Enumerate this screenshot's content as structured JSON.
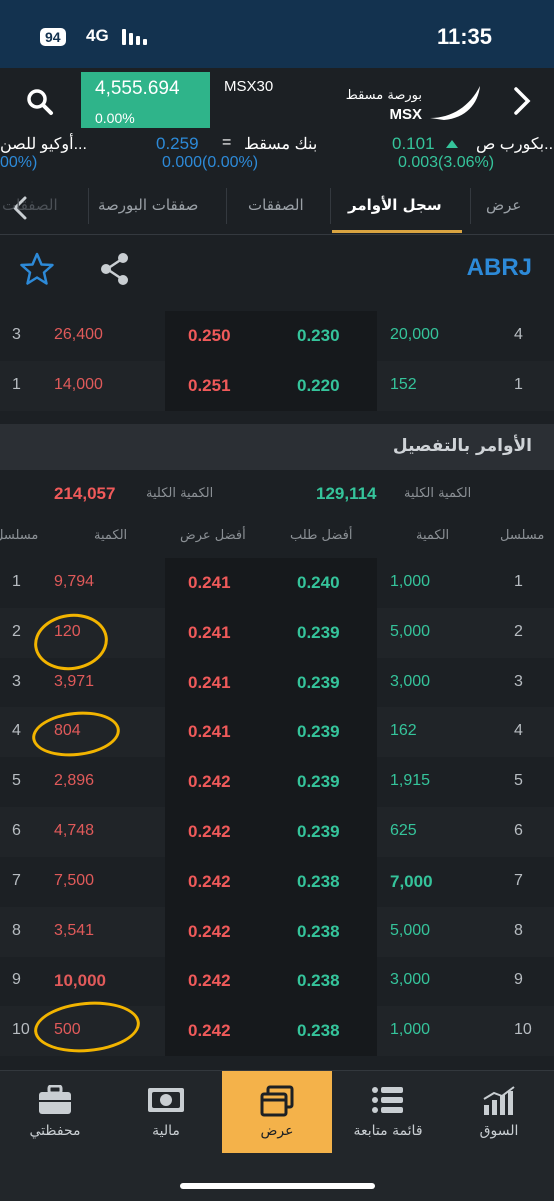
{
  "status": {
    "battery": "94",
    "network": "4G",
    "time": "11:35"
  },
  "header": {
    "index_value": "4,555.694",
    "index_change": "0.00%",
    "index_name": "MSX30",
    "brand_line1": "بورصة مسقط",
    "brand_line2": "MSX"
  },
  "ticker": [
    {
      "name": "أوكيو للصن...",
      "pct": "00%)"
    },
    {
      "name": "بنك مسقط",
      "price": "0.259",
      "mark": "=",
      "change": "0.000(0.00%)"
    },
    {
      "name": "بكورب ص...",
      "price": "0.101",
      "change": "0.003(3.06%)"
    }
  ],
  "tabs": [
    "عرض",
    "سجل الأوامر",
    "الصفقات",
    "صفقات البورصة",
    "الصفقات"
  ],
  "active_tab": "سجل الأوامر",
  "symbol": "ABRJ",
  "summary_rows": [
    {
      "seq_r": "4",
      "qty_r": "20,000",
      "bid": "0.230",
      "ask": "0.250",
      "qty_l": "26,400",
      "seq_l": "3"
    },
    {
      "seq_r": "1",
      "qty_r": "152",
      "bid": "0.220",
      "ask": "0.251",
      "qty_l": "14,000",
      "seq_l": "1"
    }
  ],
  "section_title": "الأوامر بالتفصيل",
  "totals": {
    "label": "الكمية الكلية",
    "bid_total": "129,114",
    "ask_total": "214,057"
  },
  "columns": {
    "seq_r": "مسلسل",
    "qty_r": "الكمية",
    "best_bid": "أفضل طلب",
    "best_ask": "أفضل عرض",
    "qty_l": "الكمية",
    "seq_l": "مسلسل"
  },
  "detail_rows": [
    {
      "seq_r": "1",
      "qty_r": "1,000",
      "bid": "0.240",
      "ask": "0.241",
      "qty_l": "9,794",
      "seq_l": "1"
    },
    {
      "seq_r": "2",
      "qty_r": "5,000",
      "bid": "0.239",
      "ask": "0.241",
      "qty_l": "120",
      "seq_l": "2"
    },
    {
      "seq_r": "3",
      "qty_r": "3,000",
      "bid": "0.239",
      "ask": "0.241",
      "qty_l": "3,971",
      "seq_l": "3"
    },
    {
      "seq_r": "4",
      "qty_r": "162",
      "bid": "0.239",
      "ask": "0.241",
      "qty_l": "804",
      "seq_l": "4"
    },
    {
      "seq_r": "5",
      "qty_r": "1,915",
      "bid": "0.239",
      "ask": "0.242",
      "qty_l": "2,896",
      "seq_l": "5"
    },
    {
      "seq_r": "6",
      "qty_r": "625",
      "bid": "0.239",
      "ask": "0.242",
      "qty_l": "4,748",
      "seq_l": "6"
    },
    {
      "seq_r": "7",
      "qty_r": "7,000",
      "bid": "0.238",
      "ask": "0.242",
      "qty_l": "7,500",
      "seq_l": "7"
    },
    {
      "seq_r": "8",
      "qty_r": "5,000",
      "bid": "0.238",
      "ask": "0.242",
      "qty_l": "3,541",
      "seq_l": "8"
    },
    {
      "seq_r": "9",
      "qty_r": "3,000",
      "bid": "0.238",
      "ask": "0.242",
      "qty_l": "10,000",
      "seq_l": "9"
    },
    {
      "seq_r": "10",
      "qty_r": "1,000",
      "bid": "0.238",
      "ask": "0.242",
      "qty_l": "500",
      "seq_l": "10"
    }
  ],
  "bottom_nav": [
    "السوق",
    "قائمة متابعة",
    "عرض",
    "مالية",
    "محفظتي"
  ],
  "active_nav": "عرض",
  "colors": {
    "bid": "#35c49b",
    "ask": "#f05a5a",
    "accent": "#f4b24a",
    "symbol": "#2d8ad8",
    "annotation": "#f2b400"
  }
}
